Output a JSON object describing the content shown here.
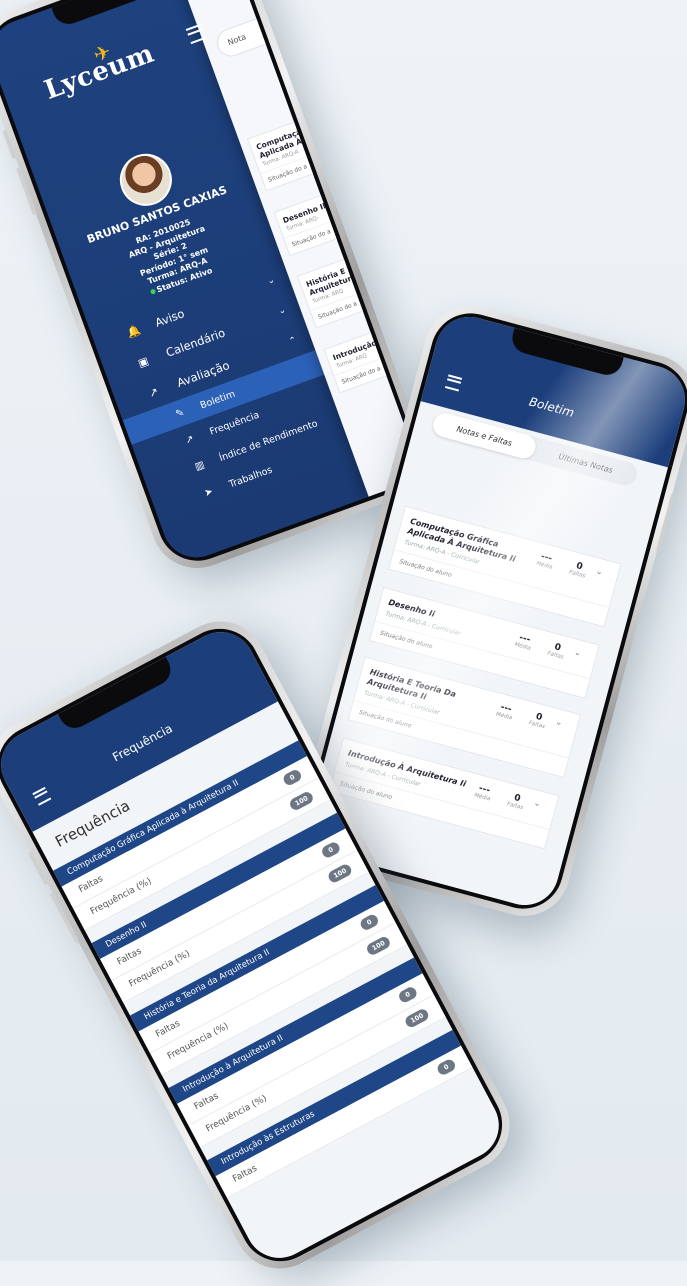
{
  "menu_phone": {
    "logo": "Lyceum",
    "student": {
      "name": "BRUNO SANTOS CAXIAS",
      "ra": "RA: 2010025",
      "course": "ARQ - Arquitetura",
      "serie": "Série: 2",
      "periodo": "Período: 1° sem",
      "turma": "Turma: ARQ-A",
      "status": "Status: Ativo"
    },
    "menu": [
      {
        "label": "Aviso",
        "icon": "bell-icon"
      },
      {
        "label": "Calendário",
        "icon": "calendar-icon"
      },
      {
        "label": "Avaliação",
        "icon": "chart-icon"
      }
    ],
    "submenu": [
      {
        "label": "Boletim",
        "icon": "edit-icon",
        "active": true
      },
      {
        "label": "Frequência",
        "icon": "trend-icon",
        "active": false
      },
      {
        "label": "Índice de Rendimento",
        "icon": "bar-chart-icon",
        "active": false
      },
      {
        "label": "Trabalhos",
        "icon": "send-icon",
        "active": false
      }
    ],
    "panel": {
      "search": "Nota",
      "cards": [
        {
          "title": "Computação Aplicada À",
          "turma": "Turma: ARQ-A",
          "situacao": "Situação do a"
        },
        {
          "title": "Desenho II",
          "turma": "Turma: ARQ-",
          "situacao": "Situação do a"
        },
        {
          "title": "História E T Arquitetur",
          "turma": "Turma: ARQ",
          "situacao": "Situação do a"
        },
        {
          "title": "Introdução",
          "turma": "Turma: ARQ",
          "situacao": "Situação do a"
        }
      ]
    }
  },
  "boletim_phone": {
    "title": "Boletim",
    "tabs": [
      "Notas e Faltas",
      "Últimas Notas"
    ],
    "media_label": "Média",
    "faltas_label": "Faltas",
    "courses": [
      {
        "name": "Computação Gráfica Aplicada À Arquitetura Ii",
        "turma": "Turma: ARQ-A - Curricular",
        "media": "---",
        "faltas": "0",
        "situacao": "Situação do aluno"
      },
      {
        "name": "Desenho Ii",
        "turma": "Turma: ARQ-A - Curricular",
        "media": "---",
        "faltas": "0",
        "situacao": "Situação do aluno"
      },
      {
        "name": "História E Teoria Da Arquitetura Ii",
        "turma": "Turma: ARQ-A - Curricular",
        "media": "---",
        "faltas": "0",
        "situacao": "Situação do aluno"
      },
      {
        "name": "Introdução À Arquitetura Ii",
        "turma": "Turma: ARQ-A - Curricular",
        "media": "---",
        "faltas": "0",
        "situacao": "Situação do aluno"
      }
    ]
  },
  "frequencia_phone": {
    "header": "Frequência",
    "page_title": "Frequência",
    "faltas_label": "Faltas",
    "freq_label": "Frequência (%)",
    "sections": [
      {
        "name": "Computação Gráfica Aplicada à Arquitetura II",
        "faltas": "0",
        "freq": "100"
      },
      {
        "name": "Desenho II",
        "faltas": "0",
        "freq": "100"
      },
      {
        "name": "História e Teoria da Arquitetura II",
        "faltas": "0",
        "freq": "100"
      },
      {
        "name": "Introdução à Arquitetura II",
        "faltas": "0",
        "freq": "100"
      },
      {
        "name": "Introdução às Estruturas",
        "faltas": "0",
        "freq": ""
      }
    ]
  },
  "colors": {
    "brand_blue": "#1c3f7c",
    "active_blue": "#2c61b8",
    "logo_accent": "#f3b617"
  }
}
